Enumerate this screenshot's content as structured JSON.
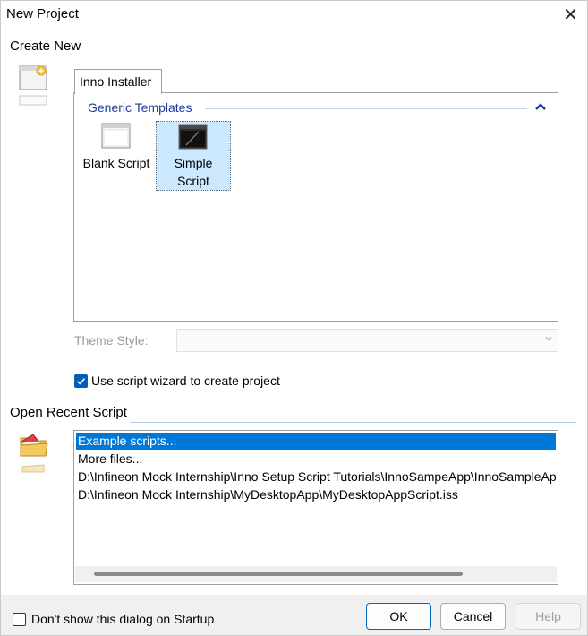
{
  "window": {
    "title": "New Project",
    "close_glyph": "✕"
  },
  "create_new": {
    "label": "Create New",
    "tab_label": "Inno Installer",
    "group_title": "Generic Templates",
    "templates": [
      {
        "label": "Blank Script",
        "icon": "blank-script-icon",
        "selected": false
      },
      {
        "label_line1": "Simple",
        "label_line2": "Script",
        "icon": "simple-script-icon",
        "selected": true
      }
    ],
    "theme_style_label": "Theme Style:",
    "theme_style_value": "",
    "wizard_checkbox_label": "Use script wizard to create project",
    "wizard_checked": true
  },
  "open_recent": {
    "label": "Open Recent Script",
    "items": [
      "Example scripts...",
      "More files...",
      "D:\\Infineon Mock Internship\\Inno Setup Script Tutorials\\InnoSampeApp\\InnoSampleAppScript.iss",
      "D:\\Infineon Mock Internship\\MyDesktopApp\\MyDesktopAppScript.iss"
    ],
    "selected_index": 0
  },
  "footer": {
    "dont_show_label": "Don't show this dialog on Startup",
    "dont_show_checked": false,
    "ok_label": "OK",
    "cancel_label": "Cancel",
    "help_label": "Help"
  },
  "colors": {
    "accent": "#0078d7",
    "group_title": "#1d3c9c",
    "selection_bg": "#cce8ff"
  }
}
